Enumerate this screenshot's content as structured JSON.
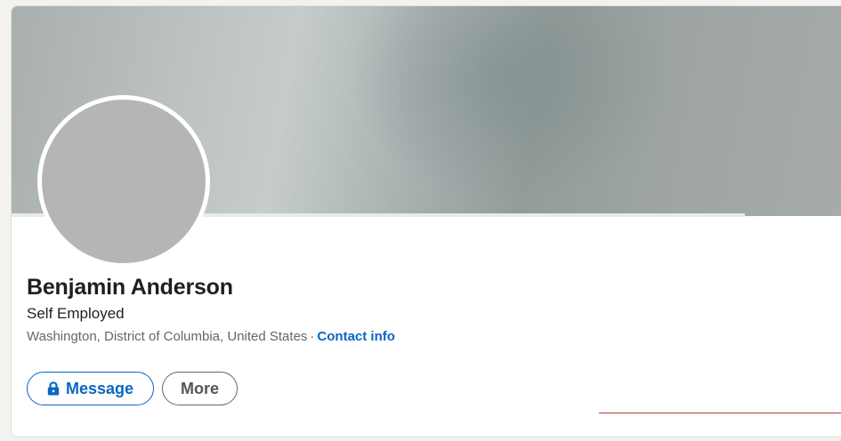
{
  "profile": {
    "name": "Benjamin Anderson",
    "headline": "Self Employed",
    "location": "Washington, District of Columbia, United States",
    "separator": "·",
    "contact_label": "Contact info"
  },
  "actions": {
    "message_label": "Message",
    "more_label": "More",
    "message_icon": "lock-icon"
  },
  "colors": {
    "accent": "#0a66c2",
    "avatar_placeholder": "#b5b6b3",
    "page_background": "#f4f2ee",
    "annotation_line": "#a5433f"
  }
}
